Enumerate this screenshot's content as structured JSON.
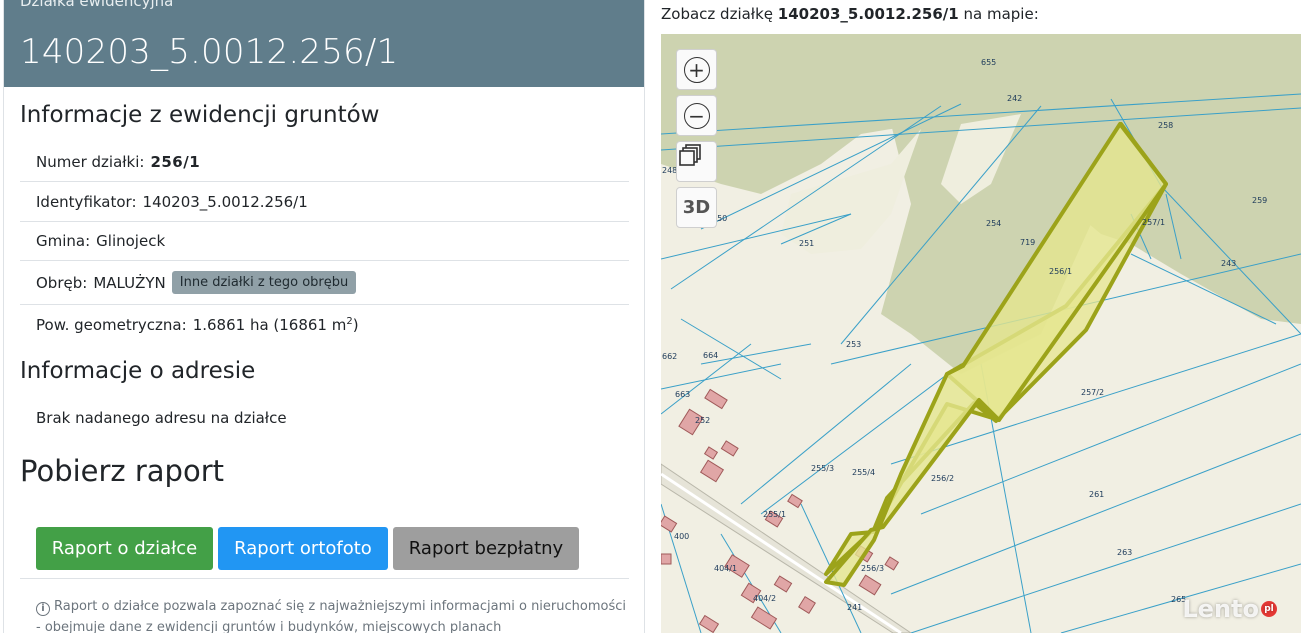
{
  "header": {
    "subtitle": "Działka ewidencyjna",
    "title": "140203_5.0012.256/1"
  },
  "ewidencja": {
    "section_title": "Informacje z ewidencji gruntów",
    "numer_label": "Numer działki:",
    "numer_value": "256/1",
    "identyfikator_label": "Identyfikator:",
    "identyfikator_value": "140203_5.0012.256/1",
    "gmina_label": "Gmina:",
    "gmina_value": "Glinojeck",
    "obreb_label": "Obręb:",
    "obreb_value": "MALUŻYN",
    "obreb_button": "Inne działki z tego obrębu",
    "pow_label": "Pow. geometryczna:",
    "pow_value": "1.6861 ha (16861 m",
    "pow_sup": "2",
    "pow_close": ")"
  },
  "adres": {
    "section_title": "Informacje o adresie",
    "text": "Brak nadanego adresu na działce"
  },
  "raport": {
    "section_title": "Pobierz raport",
    "btn_dzialka": "Raport o działce",
    "btn_ortofoto": "Raport ortofoto",
    "btn_bezplatny": "Raport bezpłatny",
    "info_text": "Raport o działce pozwala zapoznać się z najważniejszymi informacjami o nieruchomości - obejmuje dane z ewidencji gruntów i budynków, miejscowych planach zagospodarowania"
  },
  "map": {
    "caption_prefix": "Zobacz działkę",
    "caption_id": "140203_5.0012.256/1",
    "caption_suffix": "na mapie:",
    "ctrl_3d": "3D",
    "ctrl_zoom_in": "+",
    "ctrl_zoom_out": "−",
    "watermark": "Lento",
    "watermark_pl": "pl",
    "labels": [
      "655",
      "242",
      "258",
      "248",
      "259",
      "254",
      "719",
      "257/1",
      "250",
      "251",
      "243",
      "256/1",
      "253",
      "662",
      "664",
      "663",
      "252",
      "257/2",
      "255/3",
      "255/4",
      "256/2",
      "261",
      "255/1",
      "400",
      "263",
      "404/1",
      "256/3",
      "404/2",
      "241",
      "265"
    ]
  },
  "colors": {
    "header_bg": "#607d8b",
    "btn_green": "#43a047",
    "btn_blue": "#2196f3",
    "btn_gray": "#9e9e9e",
    "parcel_outline": "#9ca31a",
    "parcel_fill": "#e5e68f",
    "forest": "#cdd3b0",
    "boundary": "#3aa0c8"
  }
}
